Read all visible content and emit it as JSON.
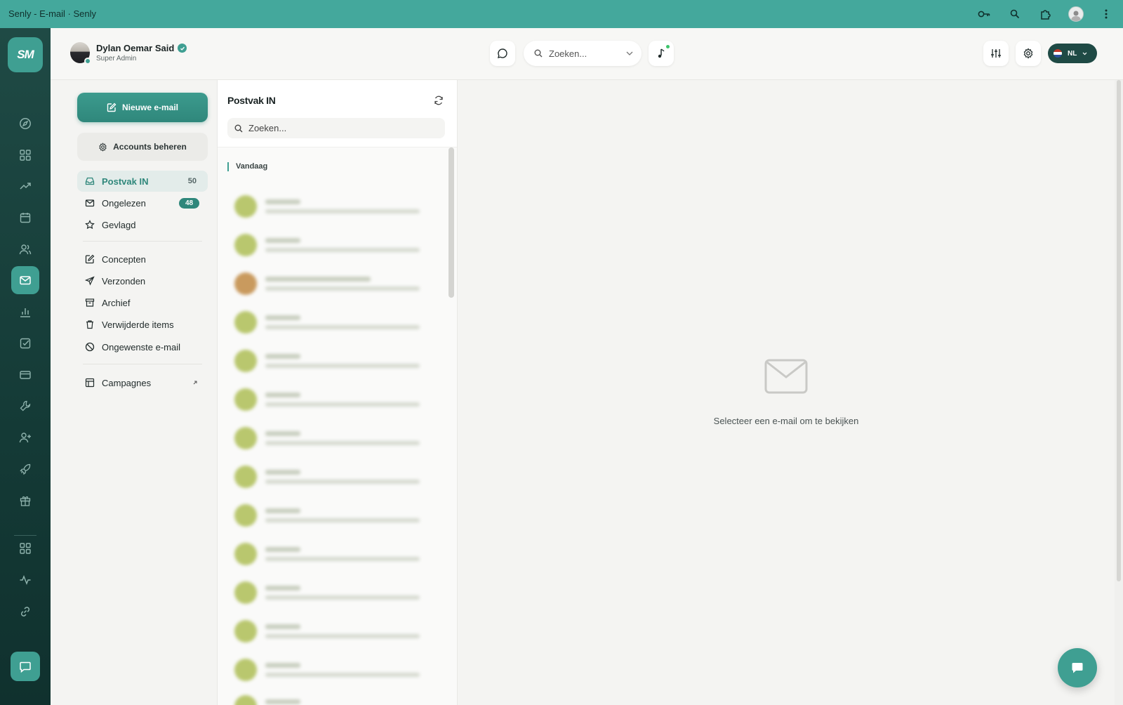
{
  "window": {
    "title": "Senly - E-mail · Senly"
  },
  "app": {
    "logo_text": "SM",
    "accent": "#3f9f92",
    "dark": "#1f4a45"
  },
  "user": {
    "name": "Dylan Oemar Said",
    "role": "Super Admin"
  },
  "header": {
    "search_placeholder": "Zoeken...",
    "language": "NL"
  },
  "folders": {
    "new_email": "Nieuwe e-mail",
    "manage_accounts": "Accounts beheren",
    "items": [
      {
        "label": "Postvak IN",
        "count": "50"
      },
      {
        "label": "Ongelezen",
        "badge": "48"
      },
      {
        "label": "Gevlagd"
      },
      {
        "label": "Concepten"
      },
      {
        "label": "Verzonden"
      },
      {
        "label": "Archief"
      },
      {
        "label": "Verwijderde items"
      },
      {
        "label": "Ongewenste e-mail"
      },
      {
        "label": "Campagnes"
      }
    ]
  },
  "message_list": {
    "title": "Postvak IN",
    "search_placeholder": "Zoeken...",
    "group_label": "Vandaag"
  },
  "reading_pane": {
    "empty_text": "Selecteer een e-mail om te bekijken"
  }
}
